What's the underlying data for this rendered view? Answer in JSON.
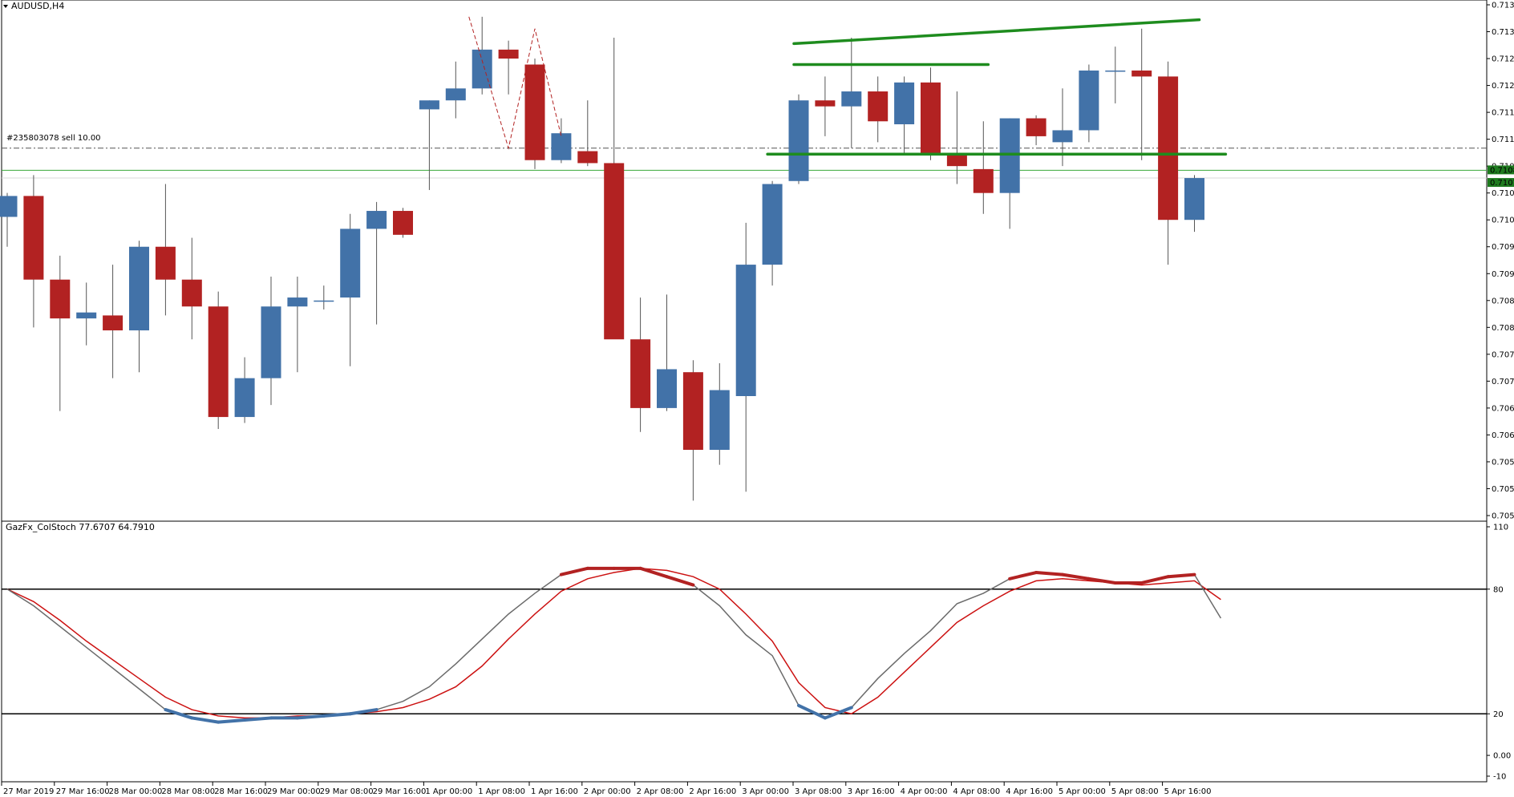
{
  "window": {
    "symbol_title": "AUDUSD,H4",
    "order_label": "#235803078 sell 10.00"
  },
  "colors": {
    "bull": "#4272a8",
    "bear": "#b22222",
    "wick": "#555555",
    "trend": "#1e8c1e",
    "price_line": "#3aa83a",
    "ask_line": "#d9d9d9",
    "order_line": "#555555",
    "stoch_main": "#6b6b6b",
    "stoch_signal": "#cc1111",
    "stoch_hot": "#b22222",
    "stoch_cold": "#4272a8",
    "level_line": "#000000",
    "price_tag_bg": "#1e7a1e",
    "price_tag_text": "#ffffff"
  },
  "chart_data": [
    {
      "type": "candlestick",
      "title": "AUDUSD,H4",
      "ylim": [
        0.70505,
        0.7136
      ],
      "y_ticks": [
        "0.71360",
        "0.71315",
        "0.71270",
        "0.71225",
        "0.71180",
        "0.71135",
        "0.71090",
        "0.71045",
        "0.71000",
        "0.70955",
        "0.70910",
        "0.70865",
        "0.70820",
        "0.70775",
        "0.70730",
        "0.70685",
        "0.70640",
        "0.70595",
        "0.70550",
        "0.70505"
      ],
      "x_tick_labels": [
        "27 Mar 2019",
        "27 Mar 16:00",
        "28 Mar 00:00",
        "28 Mar 08:00",
        "28 Mar 16:00",
        "29 Mar 00:00",
        "29 Mar 08:00",
        "29 Mar 16:00",
        "1 Apr 00:00",
        "1 Apr 08:00",
        "1 Apr 16:00",
        "2 Apr 00:00",
        "2 Apr 08:00",
        "2 Apr 16:00",
        "3 Apr 00:00",
        "3 Apr 08:00",
        "3 Apr 16:00",
        "4 Apr 00:00",
        "4 Apr 08:00",
        "4 Apr 16:00",
        "5 Apr 00:00",
        "5 Apr 08:00",
        "5 Apr 16:00"
      ],
      "candles": [
        {
          "o": 0.71005,
          "h": 0.71045,
          "l": 0.70955,
          "c": 0.7104
        },
        {
          "o": 0.7104,
          "h": 0.71075,
          "l": 0.7082,
          "c": 0.709
        },
        {
          "o": 0.709,
          "h": 0.7094,
          "l": 0.7068,
          "c": 0.70835
        },
        {
          "o": 0.70835,
          "h": 0.70895,
          "l": 0.7079,
          "c": 0.70845
        },
        {
          "o": 0.7084,
          "h": 0.70925,
          "l": 0.70735,
          "c": 0.70815
        },
        {
          "o": 0.70815,
          "h": 0.70965,
          "l": 0.70745,
          "c": 0.70955
        },
        {
          "o": 0.70955,
          "h": 0.7106,
          "l": 0.7084,
          "c": 0.709
        },
        {
          "o": 0.709,
          "h": 0.7097,
          "l": 0.708,
          "c": 0.70855
        },
        {
          "o": 0.70855,
          "h": 0.7088,
          "l": 0.7065,
          "c": 0.7067
        },
        {
          "o": 0.7067,
          "h": 0.7077,
          "l": 0.7066,
          "c": 0.70735
        },
        {
          "o": 0.70735,
          "h": 0.70905,
          "l": 0.7069,
          "c": 0.70855
        },
        {
          "o": 0.70855,
          "h": 0.70905,
          "l": 0.70745,
          "c": 0.7087
        },
        {
          "o": 0.70865,
          "h": 0.7089,
          "l": 0.7085,
          "c": 0.70865
        },
        {
          "o": 0.7087,
          "h": 0.7101,
          "l": 0.70755,
          "c": 0.70985
        },
        {
          "o": 0.70985,
          "h": 0.7103,
          "l": 0.70825,
          "c": 0.71015
        },
        {
          "o": 0.71015,
          "h": 0.7102,
          "l": 0.7097,
          "c": 0.70975
        },
        {
          "o": 0.71185,
          "h": 0.712,
          "l": 0.7105,
          "c": 0.712
        },
        {
          "o": 0.712,
          "h": 0.71265,
          "l": 0.7117,
          "c": 0.7122
        },
        {
          "o": 0.7122,
          "h": 0.7134,
          "l": 0.7121,
          "c": 0.71285
        },
        {
          "o": 0.71285,
          "h": 0.713,
          "l": 0.7121,
          "c": 0.7127
        },
        {
          "o": 0.7126,
          "h": 0.7127,
          "l": 0.71085,
          "c": 0.711
        },
        {
          "o": 0.711,
          "h": 0.7117,
          "l": 0.71095,
          "c": 0.71145
        },
        {
          "o": 0.71115,
          "h": 0.712,
          "l": 0.7109,
          "c": 0.71095
        },
        {
          "o": 0.71095,
          "h": 0.71305,
          "l": 0.71005,
          "c": 0.708
        },
        {
          "o": 0.708,
          "h": 0.7087,
          "l": 0.70645,
          "c": 0.70685
        },
        {
          "o": 0.70685,
          "h": 0.70875,
          "l": 0.7068,
          "c": 0.7075
        },
        {
          "o": 0.70745,
          "h": 0.70765,
          "l": 0.7053,
          "c": 0.70615
        },
        {
          "o": 0.70615,
          "h": 0.7076,
          "l": 0.7059,
          "c": 0.70715
        },
        {
          "o": 0.70705,
          "h": 0.70995,
          "l": 0.70545,
          "c": 0.70925
        },
        {
          "o": 0.70925,
          "h": 0.71065,
          "l": 0.7089,
          "c": 0.7106
        },
        {
          "o": 0.71065,
          "h": 0.7121,
          "l": 0.7106,
          "c": 0.712
        },
        {
          "o": 0.712,
          "h": 0.7124,
          "l": 0.7114,
          "c": 0.7119
        },
        {
          "o": 0.7119,
          "h": 0.71305,
          "l": 0.7112,
          "c": 0.71215
        },
        {
          "o": 0.71215,
          "h": 0.7124,
          "l": 0.7113,
          "c": 0.71165
        },
        {
          "o": 0.7116,
          "h": 0.7124,
          "l": 0.7111,
          "c": 0.7123
        },
        {
          "o": 0.7123,
          "h": 0.71255,
          "l": 0.711,
          "c": 0.7111
        },
        {
          "o": 0.7111,
          "h": 0.71215,
          "l": 0.7106,
          "c": 0.7109
        },
        {
          "o": 0.71085,
          "h": 0.71165,
          "l": 0.7101,
          "c": 0.71045
        },
        {
          "o": 0.71045,
          "h": 0.7117,
          "l": 0.70985,
          "c": 0.7117
        },
        {
          "o": 0.7117,
          "h": 0.71175,
          "l": 0.71125,
          "c": 0.7114
        },
        {
          "o": 0.7113,
          "h": 0.7122,
          "l": 0.7109,
          "c": 0.7115
        },
        {
          "o": 0.7115,
          "h": 0.7126,
          "l": 0.7113,
          "c": 0.7125
        },
        {
          "o": 0.7125,
          "h": 0.7129,
          "l": 0.71195,
          "c": 0.7125
        },
        {
          "o": 0.7125,
          "h": 0.7132,
          "l": 0.711,
          "c": 0.7124
        },
        {
          "o": 0.7124,
          "h": 0.71265,
          "l": 0.70925,
          "c": 0.71
        },
        {
          "o": 0.71,
          "h": 0.71075,
          "l": 0.7098,
          "c": 0.7107
        }
      ],
      "horizontal_lines": {
        "order_price": 0.7112,
        "bid_price": 0.71083,
        "ask_price": 0.7107,
        "bid_label": "0.71083",
        "ask_label": "0.71070"
      },
      "trendlines": [
        {
          "i1": 30,
          "p1": 0.71295,
          "i2": 45,
          "p2": 0.71335
        },
        {
          "i1": 30,
          "p1": 0.7126,
          "i2": 37,
          "p2": 0.7126
        },
        {
          "i1": 29,
          "p1": 0.7111,
          "i2": 46,
          "p2": 0.7111
        }
      ],
      "zigzag": [
        {
          "i": 17.5,
          "p": 0.7134
        },
        {
          "i": 19.0,
          "p": 0.7112
        },
        {
          "i": 20.0,
          "p": 0.7132
        },
        {
          "i": 21.0,
          "p": 0.7114
        }
      ]
    },
    {
      "type": "line",
      "title": "GazFx_ColStoch 77.6707 64.7910",
      "ylim": [
        -10,
        110
      ],
      "y_ticks": [
        "110",
        "80",
        "20",
        "0.00",
        "-10"
      ],
      "levels": [
        80,
        20
      ],
      "series": [
        {
          "values": [
            80,
            72,
            62,
            52,
            42,
            32,
            22,
            18,
            16,
            17,
            18,
            18,
            19,
            20,
            22,
            26,
            33,
            44,
            56,
            68,
            78,
            87,
            90,
            90,
            90,
            86,
            82,
            72,
            58,
            48,
            24,
            18,
            23,
            37,
            49,
            60,
            73,
            78,
            85,
            88,
            87,
            85,
            83,
            83,
            86,
            87,
            66
          ]
        },
        {
          "values": [
            80,
            74,
            65,
            55,
            46,
            37,
            28,
            22,
            19,
            18,
            18,
            19,
            19,
            20,
            21,
            23,
            27,
            33,
            43,
            56,
            68,
            79,
            85,
            88,
            90,
            89,
            86,
            80,
            68,
            55,
            35,
            23,
            20,
            28,
            40,
            52,
            64,
            72,
            79,
            84,
            85,
            84,
            83,
            82,
            83,
            84,
            75
          ]
        }
      ]
    }
  ]
}
